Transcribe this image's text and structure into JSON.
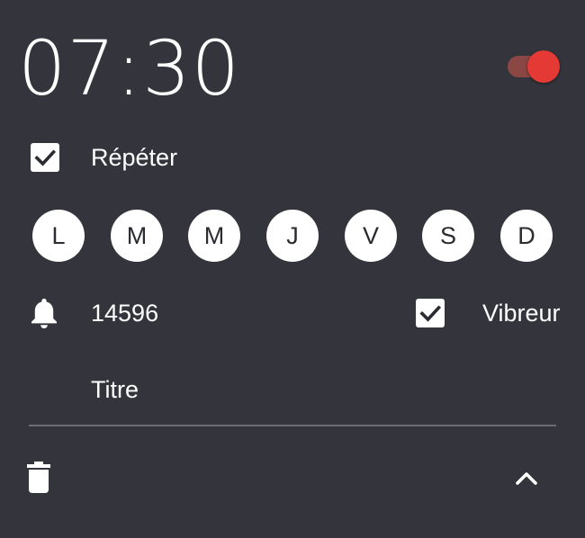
{
  "alarm": {
    "time": "07:30",
    "enabled": true,
    "repeat_label": "Répéter",
    "repeat_checked": true,
    "days": [
      "L",
      "M",
      "M",
      "J",
      "V",
      "S",
      "D"
    ],
    "ringtone": "14596",
    "vibrate_label": "Vibreur",
    "vibrate_checked": true,
    "title_placeholder": "Titre"
  },
  "colors": {
    "background": "#34353c",
    "accent": "#e53935",
    "toggle_track": "#8a4744",
    "divider": "#6c6d72"
  },
  "icons": {
    "bell": "bell-icon",
    "delete": "trash-icon",
    "collapse": "chevron-up-icon",
    "check": "check-icon"
  }
}
